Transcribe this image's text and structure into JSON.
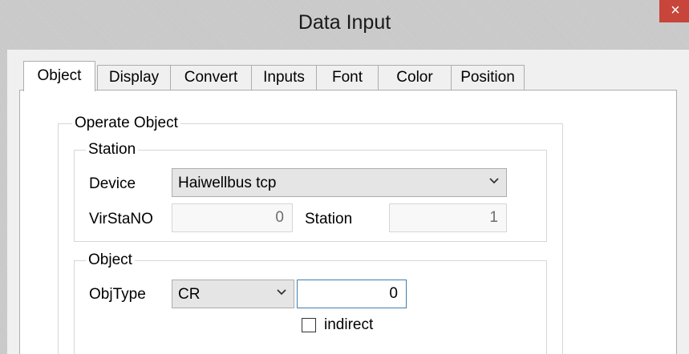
{
  "window": {
    "title": "Data Input",
    "close_glyph": "×"
  },
  "tabs": [
    "Object",
    "Display",
    "Convert",
    "Inputs",
    "Font",
    "Color",
    "Position"
  ],
  "operate_object": {
    "legend": "Operate Object",
    "station": {
      "legend": "Station",
      "device_label": "Device",
      "device_value": "Haiwellbus tcp",
      "virstano_label": "VirStaNO",
      "virstano_value": "0",
      "station_label": "Station",
      "station_value": "1"
    },
    "object": {
      "legend": "Object",
      "objtype_label": "ObjType",
      "objtype_value": "CR",
      "address_value": "0",
      "indirect_label": "indirect"
    }
  },
  "icons": {
    "close": "close-icon",
    "dropdown": "chevron-down-icon"
  }
}
